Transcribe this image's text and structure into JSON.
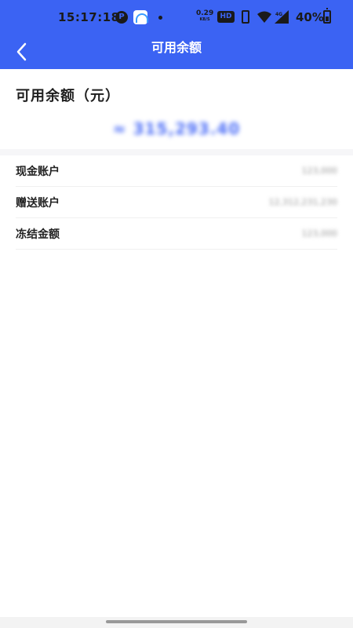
{
  "status_bar": {
    "time": "15:17:18",
    "app_icon_a": "P",
    "speed_value": "0.29",
    "speed_unit": "KB/S",
    "hd_badge": "HD",
    "battery_text": "40%"
  },
  "app_bar": {
    "title": "可用余额",
    "back_icon": "chevron-left-icon"
  },
  "summary": {
    "title": "可用余额（元）",
    "amount": "≈ 315,293.40"
  },
  "accounts": [
    {
      "label": "现金账户",
      "value": "123,000"
    },
    {
      "label": "赠送账户",
      "value": "12,312,231,230"
    },
    {
      "label": "冻结金额",
      "value": "123,000"
    }
  ],
  "colors": {
    "brand": "#3b63f3",
    "amount": "#4a6cf7"
  }
}
